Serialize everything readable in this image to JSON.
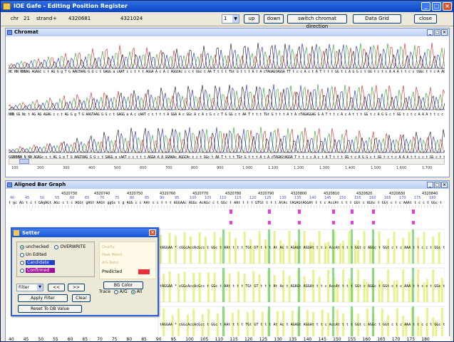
{
  "window": {
    "title": "IOE Gafe  - Editing Position Register",
    "minimize_icon": "minimize-icon",
    "maximize_icon": "maximize-icon",
    "close_icon": "close-icon"
  },
  "toolbar": {
    "chr_label": "chr",
    "chr_value": "21",
    "strand_label": "strand",
    "strand_value": "+",
    "start_pos": "4320681",
    "end_pos": "4321024",
    "select_value": "1",
    "up_label": "up",
    "down_label": "down",
    "switch_label": "switch chromat direction",
    "grid_label": "Data Grid",
    "close_label": "close"
  },
  "chromat": {
    "title": "Chromat",
    "seq1": "NC NN  NNNAG AGAGC  c t AG G  g T G  AAGTAAG  G G  c  t GAGG a  cAAT  c c  t t t AGGA  A  c A c AGGCAc c  c t GGc  t AA T t t  t TGt G  t t t  A  t A  cTAGAGtAGGA TT t c  c  A  c  t  A  T t t  t GG  t c  A  G  G c t GG  t c  t c A A A t t  c  c tGGc  t t  c A  AG  c c A",
    "nums1": [
      "40",
      "42",
      "47",
      "52",
      "57",
      "62",
      "67",
      "72",
      "77",
      "82",
      "87",
      "93",
      "98",
      "103",
      "108",
      "113",
      "118",
      "123",
      "128",
      "133",
      "138",
      "143",
      "148",
      "153",
      "158",
      "163",
      "168",
      "173",
      "178"
    ],
    "seq2": "NNN GG  Nc t AG AG AGAG c c t AG G  g T G  AAGTAAG  G G c  t GAGG a  A  c  cAAT  c c  t t t A  GGA  A c  GGc A c A  c G  c c T G GG c  t AA T t t  t  TGt G  t t t  A  t  A cTAGAGGAG  G A  T t t c  A  c  A  t t  t  GG  t  c  A  G  G c t GG  t c  t c A A A t t  c  c  t GG c  t t  c A  AG c  c A",
    "nums2": [
      "50",
      "53",
      "58",
      "63",
      "68",
      "73",
      "78",
      "83",
      "88",
      "93",
      "98",
      "103",
      "108",
      "113",
      "118",
      "123",
      "128",
      "133",
      "138",
      "143",
      "148",
      "153",
      "158",
      "163",
      "168",
      "173",
      "178"
    ],
    "seq3": "GGNNNNN  N  NN  AGAGc c t AG G  g T G  AAGTAAG  G G  c  t GAGG a  cAAT  c c t t t AGGA  A  A  GGAAAc  AGGCAc c  c t GGc t AA T t t  t TGt G t t t  A  t A cTAGAGtAGGA T t t  c  c  A  c t  A T t t  t  GG  t  c  A  G  G c t  GG  t c  t c A  A  A t t  c  c  t  GG  c  t  t c A  AG c  c A",
    "nums3": [
      "40",
      "45",
      "50",
      "55",
      "60",
      "65",
      "70",
      "75",
      "80",
      "85",
      "90",
      "95",
      "100",
      "105",
      "110",
      "115",
      "120",
      "125",
      "130",
      "135",
      "140",
      "145",
      "150",
      "155",
      "160",
      "165",
      "170",
      "175",
      "180"
    ],
    "axis": [
      "100",
      "200",
      "300",
      "400",
      "500",
      "600",
      "700",
      "800",
      "900",
      "1,000",
      "1,100",
      "1,200",
      "1,300",
      "1,400",
      "1,500",
      "1,600",
      "1,700"
    ]
  },
  "aligned": {
    "title": "Aligned Bar Graph",
    "pos_labels": [
      "4320730",
      "4320740",
      "4320750",
      "4320760",
      "4320770",
      "4320780",
      "4320790",
      "4320800",
      "4320810",
      "4320820",
      "4320830",
      "4320840",
      "4320850"
    ],
    "index_labels": [
      "40",
      "45",
      "50",
      "55",
      "60",
      "65",
      "70",
      "75",
      "80",
      "85",
      "90",
      "95",
      "100",
      "105",
      "110",
      "115",
      "120",
      "125",
      "130",
      "135",
      "140",
      "145",
      "150",
      "155",
      "160",
      "165",
      "170",
      "175",
      "180"
    ],
    "ref_seq": "t gc AG  t c t  GAgAGt AGc c t c  AGGt  gAGt AAGt ggGc t g AGG c c AAt c c  t t  t  AGGAAc AGGc AcAGc c  t GGc  t AAt t  t  t GTGt t  t  t AtAc tAGAGtAGGAt  t  t  c AccAt  t  t  t GGt c AGGc  t GGt c  t c AAAt  t  c  c  t GGc  t  t  c AAGc c",
    "read_seq": "tAGGAA  *  cGGcAccAcGcc  t GGc  t AAt  t  t  t  TGt GT  t  t  t  At Ac  t AGAGt AGGAt  t  t  c AccAt  t  t  t  GGt  c AGGc  t GGt  c  t  c AAA t  t  c  c  t GGc  t  t  c  AAGc",
    "bottom_axis": [
      "40",
      "45",
      "50",
      "55",
      "60",
      "65",
      "70",
      "75",
      "80",
      "85",
      "90",
      "95",
      "100",
      "105",
      "110",
      "115",
      "120",
      "125",
      "130",
      "135",
      "140",
      "145",
      "150",
      "155",
      "160",
      "165",
      "170",
      "175",
      "180"
    ]
  },
  "setter": {
    "title": "Setter",
    "opt_unchecked": "unchecked",
    "opt_overwrite": "OVERWRITE",
    "opt_unedited": "Un Edited",
    "opt_candidate": "Candidate",
    "opt_confirmed": "Confirmed",
    "legend_l1": "Quality",
    "legend_l2": "Peak Match",
    "legend_l3": "A/G Ratio",
    "predicted_label": "Predicted",
    "filter_value": "Filter",
    "prev_label": "<<",
    "next_label": ">>",
    "apply_label": "Apply Filter",
    "clear_label": "Clear",
    "reset_label": "Reset To DB Value",
    "bg_color_label": "BG Color",
    "trace_label": "Trace",
    "trace_ag": "A/G",
    "trace_all": "All",
    "colors": {
      "candidate": "#1f3fd0",
      "confirmed": "#a0109a",
      "predicted": "#e8303a"
    }
  }
}
